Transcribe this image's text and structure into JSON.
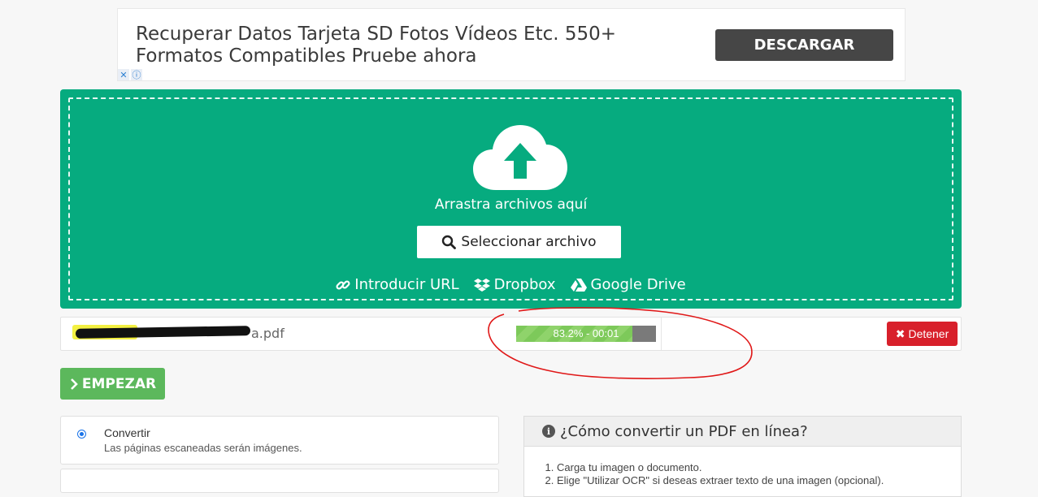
{
  "ad": {
    "text": "Recuperar Datos Tarjeta SD Fotos Vídeos Etc. 550+ Formatos Compatibles Pruebe ahora",
    "button": "DESCARGAR",
    "close_glyph": "✕",
    "info_glyph": "ⓘ"
  },
  "upload": {
    "drag_text": "Arrastra archivos aquí",
    "select_button": "Seleccionar archivo",
    "sources": {
      "url": "Introducir URL",
      "dropbox": "Dropbox",
      "gdrive": "Google Drive"
    },
    "bg_color": "#06ab7f"
  },
  "file": {
    "name_suffix": "a.pdf",
    "progress_percent": 83.2,
    "progress_label": "83.2% - 00:01",
    "stop_button": "Detener"
  },
  "actions": {
    "start_button": "EMPEZAR"
  },
  "options": [
    {
      "title": "Convertir",
      "description": "Las páginas escaneadas serán imágenes.",
      "selected": true
    }
  ],
  "howto": {
    "title": "¿Cómo convertir un PDF en línea?",
    "steps": [
      "Carga tu imagen o documento.",
      "Elige \"Utilizar OCR\" si deseas extraer texto de una imagen (opcional)."
    ]
  }
}
